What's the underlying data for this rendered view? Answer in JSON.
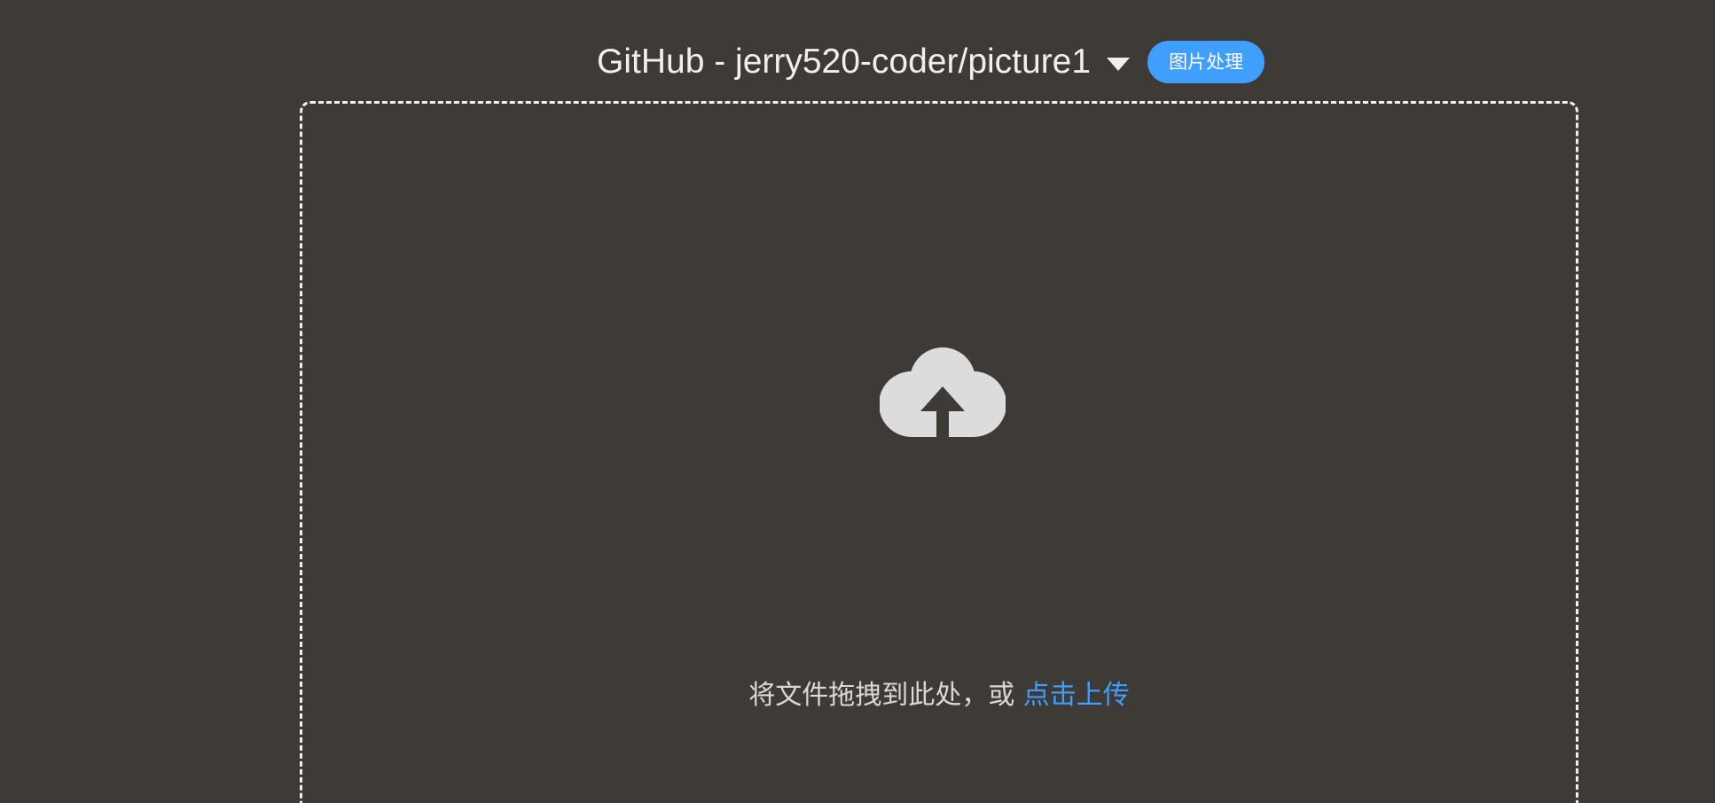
{
  "header": {
    "repo_title": "GitHub - jerry520-coder/picture1",
    "tool_button_label": "图片处理"
  },
  "upload": {
    "drop_hint": "将文件拖拽到此处，或 ",
    "click_link": "点击上传",
    "icon": "cloud-upload-icon"
  },
  "colors": {
    "background": "#3e3b37",
    "accent": "#409eff",
    "text": "#f0efed"
  }
}
